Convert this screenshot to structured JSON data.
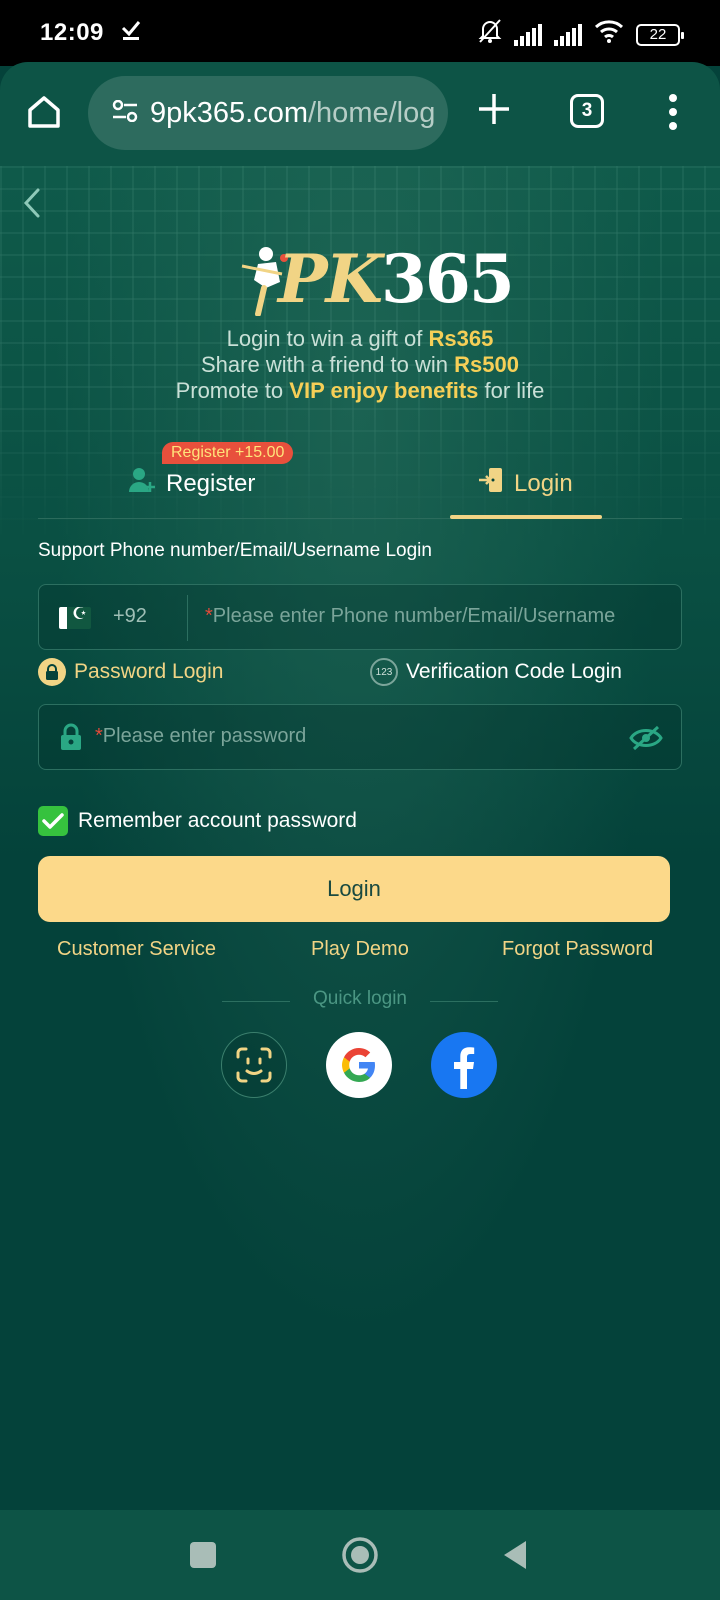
{
  "status_bar": {
    "time": "12:09",
    "battery": "22"
  },
  "browser": {
    "url_host": "9pk365.com",
    "url_path": "/home/log",
    "tab_count": "3"
  },
  "logo": {
    "brand_prefix": "PK",
    "brand_number": "365"
  },
  "promo": {
    "line1_text": "Login to win a gift of ",
    "line1_highlight": "Rs365",
    "line2_text": "Share with a friend to win ",
    "line2_highlight": "Rs500",
    "line3_prefix": "Promote to ",
    "line3_highlight": "VIP enjoy benefits",
    "line3_suffix": " for life"
  },
  "tabs": {
    "register_label": "Register",
    "register_badge": "Register +15.00",
    "login_label": "Login",
    "active": "login"
  },
  "form": {
    "support_label": "Support Phone number/Email/Username Login",
    "country_code": "+92",
    "required_mark": "*",
    "account_placeholder": "Please enter Phone number/Email/Username",
    "mode_password": "Password Login",
    "mode_code": "Verification Code Login",
    "code_icon_text": "123",
    "password_placeholder": "Please enter password",
    "remember_label": "Remember account password",
    "remember_checked": true,
    "login_button": "Login"
  },
  "links": {
    "customer_service": "Customer Service",
    "play_demo": "Play Demo",
    "forgot_password": "Forgot Password"
  },
  "quick_login": {
    "label": "Quick login",
    "providers": [
      "face-id-icon",
      "google-icon",
      "facebook-icon"
    ]
  },
  "colors": {
    "background": "#04423a",
    "accent_gold": "#f1d485",
    "highlight_yellow": "#f6cf57",
    "login_button": "#fcd98a",
    "badge_red": "#e8503c",
    "checkbox_green": "#36c23e",
    "facebook_blue": "#1877f2"
  }
}
